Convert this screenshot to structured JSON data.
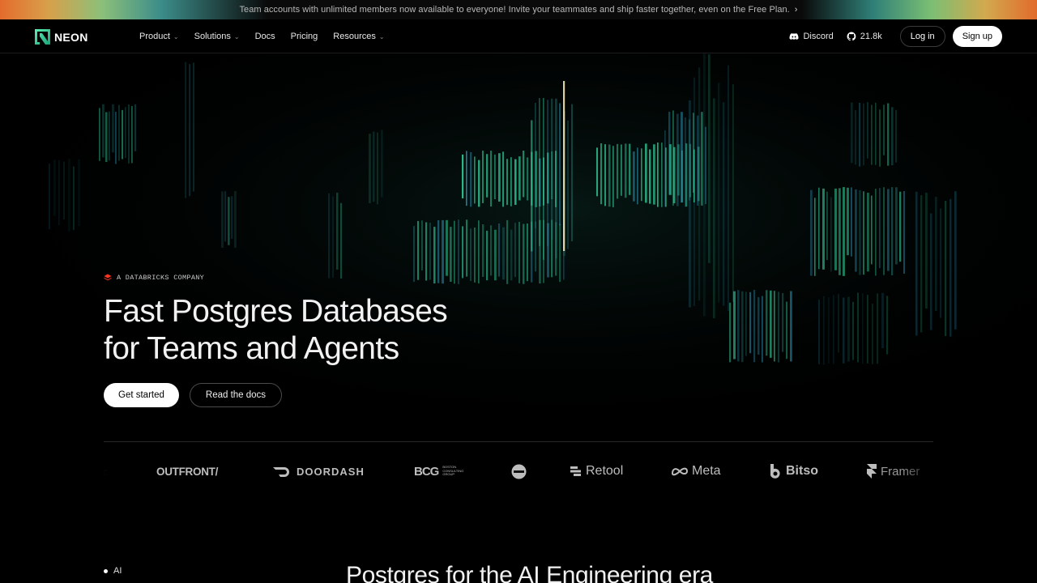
{
  "announcement": {
    "text": "Team accounts with unlimited members now available to everyone! Invite your teammates and ship faster together, even on the Free Plan.",
    "chevron": "›"
  },
  "nav": {
    "logo_text": "NEON",
    "menu": [
      {
        "label": "Product",
        "caret": "⌄"
      },
      {
        "label": "Solutions",
        "caret": "⌄"
      },
      {
        "label": "Docs"
      },
      {
        "label": "Pricing"
      },
      {
        "label": "Resources",
        "caret": "⌄"
      }
    ],
    "discord_label": "Discord",
    "github_stars": "21.8k",
    "login_label": "Log in",
    "signup_label": "Sign up"
  },
  "hero": {
    "kicker": "A DATABRICKS COMPANY",
    "headline_line1": "Fast Postgres Databases",
    "headline_line2": "for Teams and Agents",
    "primary_cta": "Get started",
    "secondary_cta": "Read the docs"
  },
  "logos": [
    {
      "name": "OUTFRONT/",
      "icon": "none"
    },
    {
      "name": "DOORDASH",
      "icon": "doordash-icon"
    },
    {
      "name": "BCG",
      "icon": "none"
    },
    {
      "name": "Retool",
      "icon": "retool-icon"
    },
    {
      "name": "Meta",
      "icon": "meta-icon"
    },
    {
      "name": "Bitso",
      "icon": "bitso-icon"
    },
    {
      "name": "Framer",
      "icon": "framer-icon"
    }
  ],
  "logos_small": {
    "bcg_sub": "BOSTON CONSULTING GROUP"
  },
  "section": {
    "side_nav_item": "AI",
    "title": "Postgres for the AI Engineering era"
  },
  "colors": {
    "accent_green": "#34d59a",
    "background": "#000000"
  }
}
